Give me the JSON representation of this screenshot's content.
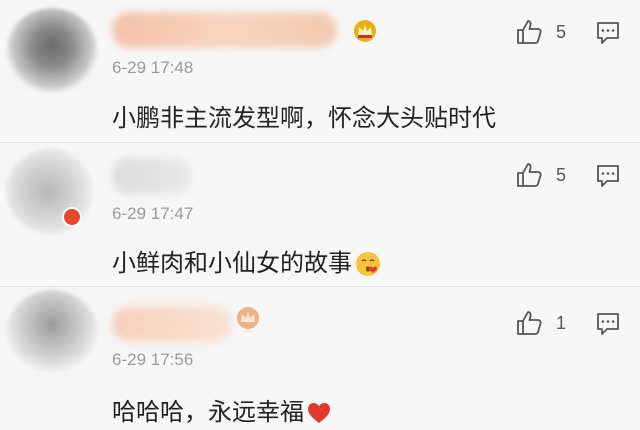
{
  "comments": [
    {
      "time": "6-29 17:48",
      "text": "小鹏非主流发型啊，怀念大头贴时代",
      "likes": "5",
      "username_icon": "crown-icon"
    },
    {
      "time": "6-29 17:47",
      "text": "小鲜肉和小仙女的故事",
      "likes": "5",
      "trailing_emoji": "blowing-kiss-emoji"
    },
    {
      "time": "6-29 17:56",
      "text": "哈哈哈，永远幸福",
      "likes": "1",
      "username_icon": "crown-icon",
      "trailing_emoji": "red-heart-emoji"
    }
  ],
  "colors": {
    "background": "#f7f7f7",
    "text": "#222222",
    "timestamp": "#9a9a9a",
    "crown": "#e9b10f",
    "heart": "#e2382c"
  }
}
